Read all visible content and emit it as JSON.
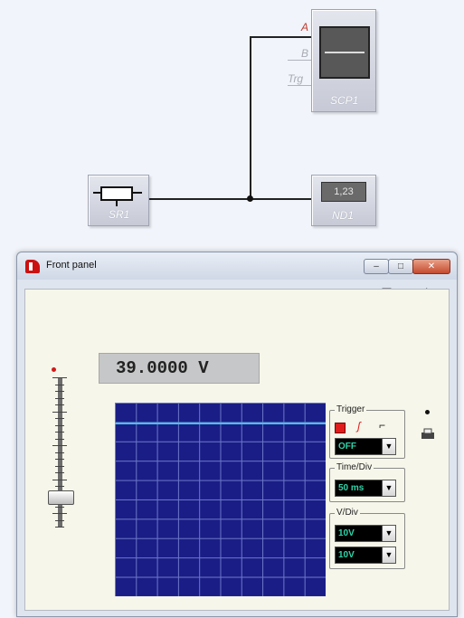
{
  "schematic": {
    "scope_block": {
      "label": "SCP1",
      "inputs": [
        "A",
        "B",
        "Trg"
      ]
    },
    "source_block": {
      "label": "SR1"
    },
    "display_block": {
      "label": "ND1",
      "value": "1,23"
    }
  },
  "window": {
    "title": "Front panel",
    "controls": {
      "minimize": "–",
      "maximize": "□",
      "close": "✕"
    },
    "toolbar_icons": [
      "open-folder-icon",
      "save-icon",
      "print-icon",
      "copy-icon",
      "tools-icon"
    ]
  },
  "panel": {
    "readout": "39.0000 V",
    "slider_level_fraction": 0.84,
    "trigger": {
      "title": "Trigger",
      "mode": "OFF"
    },
    "time_div": {
      "title": "Time/Div",
      "value": "50 ms"
    },
    "v_div": {
      "title": "V/Div",
      "channel_a": "10V",
      "channel_b": "10V"
    }
  },
  "colors": {
    "scope_background": "#1a1d86",
    "trace": "#48c2e6",
    "combo_text": "#2fd3a8",
    "trigger_active": "#e01c1c"
  }
}
